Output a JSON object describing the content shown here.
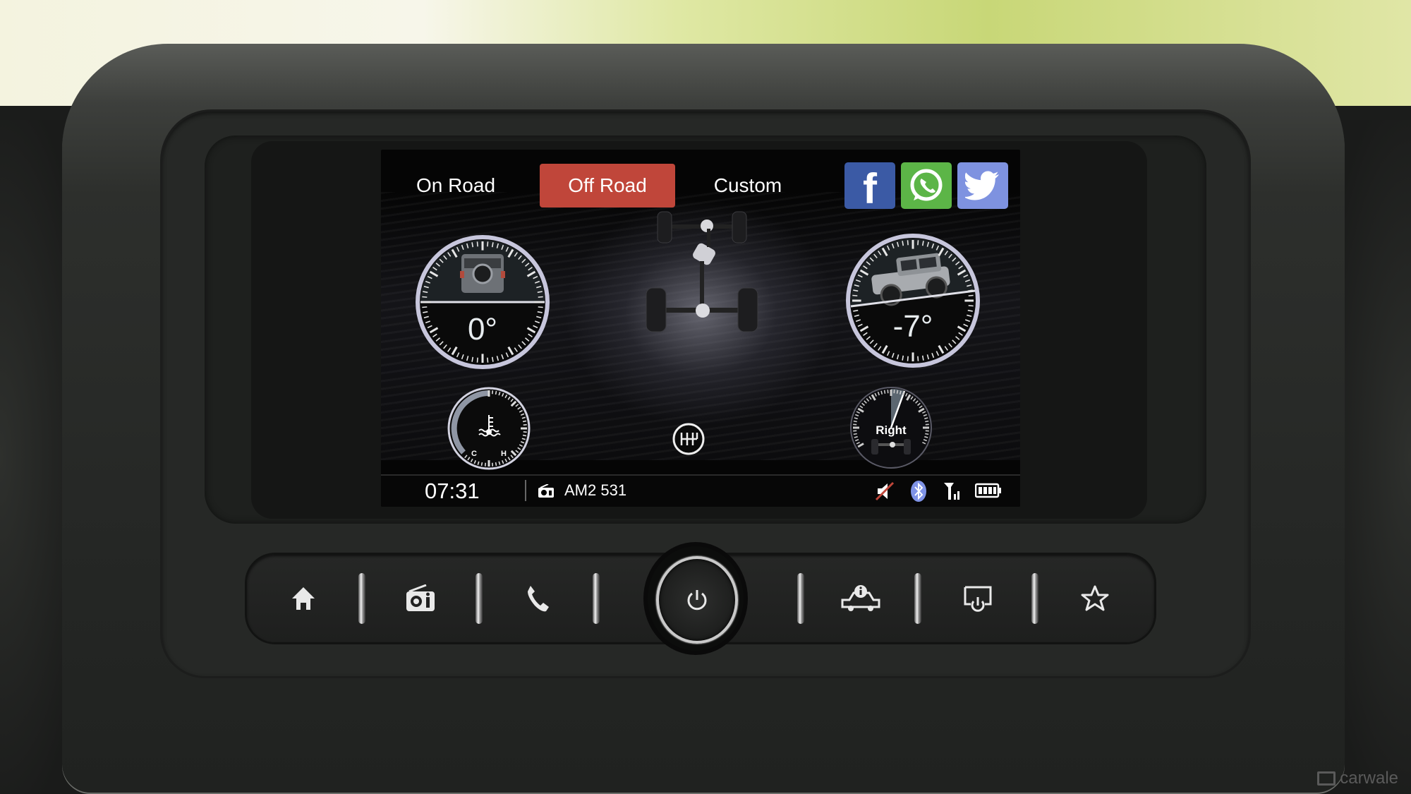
{
  "modes": [
    {
      "label": "On Road",
      "active": false
    },
    {
      "label": "Off Road",
      "active": true
    },
    {
      "label": "Custom",
      "active": false
    }
  ],
  "social": [
    {
      "name": "facebook",
      "icon": "facebook-icon",
      "glyph": "f",
      "color": "#3b5aa5"
    },
    {
      "name": "whatsapp",
      "icon": "whatsapp-icon",
      "glyph": "✆",
      "color": "#5cb547"
    },
    {
      "name": "twitter",
      "icon": "twitter-icon",
      "glyph": "🐦",
      "color": "#7e92e0"
    }
  ],
  "colors": {
    "active_mode": "#c0463a",
    "gauge_ring": "#c7c6dc",
    "bluetooth": "#7f93e6",
    "mute_slash": "#c0463a"
  },
  "gauges": {
    "roll": {
      "label": "Roll angle",
      "value": "0°"
    },
    "pitch": {
      "label": "Pitch angle",
      "value": "-7°"
    },
    "coolant": {
      "label_cold": "C",
      "label_hot": "H",
      "level_fraction": 0.5
    },
    "steering": {
      "label": "Right"
    }
  },
  "status_bar": {
    "time": "07:31",
    "source": "AM2 531",
    "icons": [
      "mute-icon",
      "bluetooth-icon",
      "signal-icon",
      "battery-icon"
    ]
  },
  "hardware_buttons": [
    {
      "name": "home",
      "icon": "home-icon",
      "glyph": "⌂"
    },
    {
      "name": "radio",
      "icon": "radio-icon",
      "glyph": "📻"
    },
    {
      "name": "phone",
      "icon": "phone-icon",
      "glyph": "✆"
    },
    {
      "name": "power",
      "icon": "power-icon",
      "glyph": "⏻"
    },
    {
      "name": "vehicle-info",
      "icon": "vehicle-info-icon",
      "glyph": "🚙"
    },
    {
      "name": "screen-off",
      "icon": "screen-off-icon",
      "glyph": "⏻"
    },
    {
      "name": "favorite",
      "icon": "star-icon",
      "glyph": "☆"
    }
  ],
  "watermark": "carwale"
}
